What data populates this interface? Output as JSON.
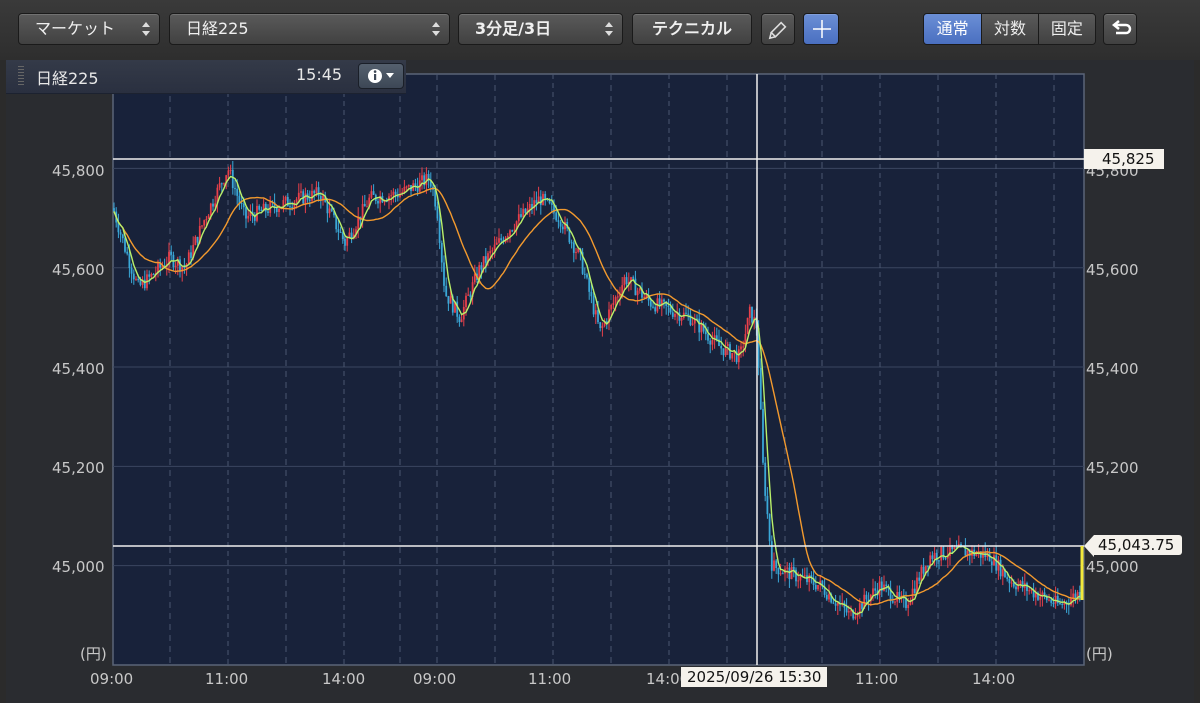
{
  "toolbar": {
    "market_select": "マーケット",
    "symbol_select": "日経225",
    "period_select": "3分足/3日",
    "technical_button": "テクニカル",
    "scale_modes": [
      "通常",
      "対数",
      "固定"
    ],
    "active_scale": "通常",
    "pencil_icon": "pencil-icon",
    "crosshair_icon": "crosshair-icon",
    "reset_icon": "undo-icon"
  },
  "info_bar": {
    "symbol": "日経225",
    "time": "15:45",
    "info_icon": "info-icon"
  },
  "chart": {
    "y_axis_left": [
      "45,800",
      "45,600",
      "45,400",
      "45,200",
      "45,000"
    ],
    "y_axis_right": [
      "45,800",
      "45,600",
      "45,400",
      "45,200",
      "45,000"
    ],
    "y_unit": "(円)",
    "x_labels": [
      "09:00",
      "11:00",
      "14:00",
      "09:00",
      "11:00",
      "14:00",
      "11:00",
      "14:00"
    ],
    "crosshair_date": "2025/09/26 15:30",
    "crosshair_price": "45,825",
    "last_price": "45,043.75",
    "colors": {
      "up": "#e8404a",
      "down": "#3aa8d8",
      "ma_short": "#b9f06a",
      "ma_long": "#f39a2e",
      "background": "#18223a"
    }
  },
  "chart_data": {
    "type": "line",
    "title": "",
    "xlabel": "",
    "ylabel": "(円)",
    "ylim": [
      44800,
      45990
    ],
    "x": [
      "D1 09:00",
      "D1 11:00",
      "D1 14:00",
      "D2 09:00",
      "D2 11:00",
      "D2 14:00",
      "D3 11:00",
      "D3 14:00"
    ],
    "series": [
      {
        "name": "",
        "values": [
          45650,
          45780,
          45720,
          45730,
          45700,
          45450,
          44960,
          44950
        ]
      },
      {
        "name": "",
        "values": [
          45630,
          45660,
          45710,
          45720,
          45690,
          45470,
          44980,
          45000
        ]
      }
    ],
    "reference_lines": [
      45825,
      45043.75
    ]
  }
}
